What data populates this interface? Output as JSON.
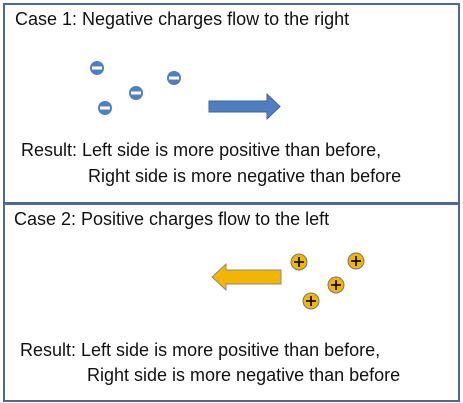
{
  "colors": {
    "border": "#4f6891",
    "negative": "#4f7fc0",
    "positive": "#f2b600",
    "arrow_blue": "#4f7fc0",
    "arrow_yellow": "#f2b600"
  },
  "case1": {
    "title": "Case 1: Negative charges flow to the right",
    "result_line1": "Result: Left side is more positive than before,",
    "result_line2": "Right side is more negative than before",
    "charge_icon": "minus-circle",
    "arrow_icon": "arrow-right"
  },
  "case2": {
    "title": "Case 2: Positive charges flow to the left",
    "result_line1": "Result: Left side is more positive than before,",
    "result_line2": "Right side is more negative than before",
    "charge_icon": "plus-circle",
    "arrow_icon": "arrow-left"
  }
}
